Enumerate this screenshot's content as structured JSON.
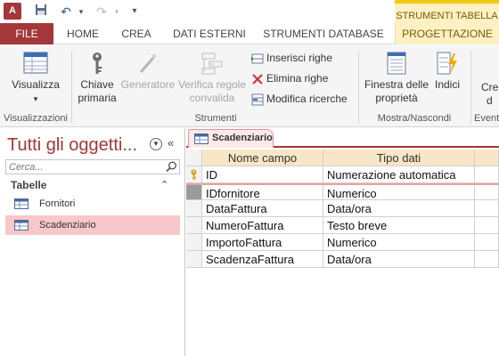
{
  "app": {
    "icon_text": "A",
    "contextual_group": "STRUMENTI TABELLA"
  },
  "tabs": {
    "file": "FILE",
    "home": "HOME",
    "crea": "CREA",
    "dati_esterni": "DATI ESTERNI",
    "strumenti_database": "STRUMENTI DATABASE",
    "progettazione": "PROGETTAZIONE"
  },
  "ribbon": {
    "visualizza": "Visualizza",
    "chiave_line1": "Chiave",
    "chiave_line2": "primaria",
    "generatore": "Generatore",
    "verifica_line1": "Verifica regole",
    "verifica_line2": "convalida",
    "inserisci_righe": "Inserisci righe",
    "elimina_righe": "Elimina righe",
    "modifica_ricerche": "Modifica ricerche",
    "finestra_line1": "Finestra delle",
    "finestra_line2": "proprietà",
    "indici": "Indici",
    "crea_partial_line1": "Cre",
    "crea_partial_line2": "d",
    "groups": {
      "visualizzazioni": "Visualizzazioni",
      "strumenti": "Strumenti",
      "mostra_nascondi": "Mostra/Nascondi",
      "eventi_partial": "Eventi"
    }
  },
  "nav": {
    "title": "Tutti gli oggetti...",
    "search_placeholder": "Cerca...",
    "group_header": "Tabelle",
    "items": [
      {
        "label": "Fornitori",
        "selected": false
      },
      {
        "label": "Scadenziario",
        "selected": true
      }
    ]
  },
  "document": {
    "tab_label": "Scadenziario",
    "headers": {
      "name": "Nome campo",
      "type": "Tipo dati"
    },
    "rows": [
      {
        "name": "ID",
        "type": "Numerazione automatica",
        "primary_key": true
      },
      {
        "name": "IDfornitore",
        "type": "Numerico",
        "current": true
      },
      {
        "name": "DataFattura",
        "type": "Data/ora"
      },
      {
        "name": "NumeroFattura",
        "type": "Testo breve"
      },
      {
        "name": "ImportoFattura",
        "type": "Numerico"
      },
      {
        "name": "ScadenzaFattura",
        "type": "Data/ora"
      }
    ]
  },
  "colors": {
    "accent": "#a4373a",
    "contextual": "#fdf1c4",
    "selected_item": "#f8c7c9",
    "grid_header": "#f8e7c6"
  }
}
